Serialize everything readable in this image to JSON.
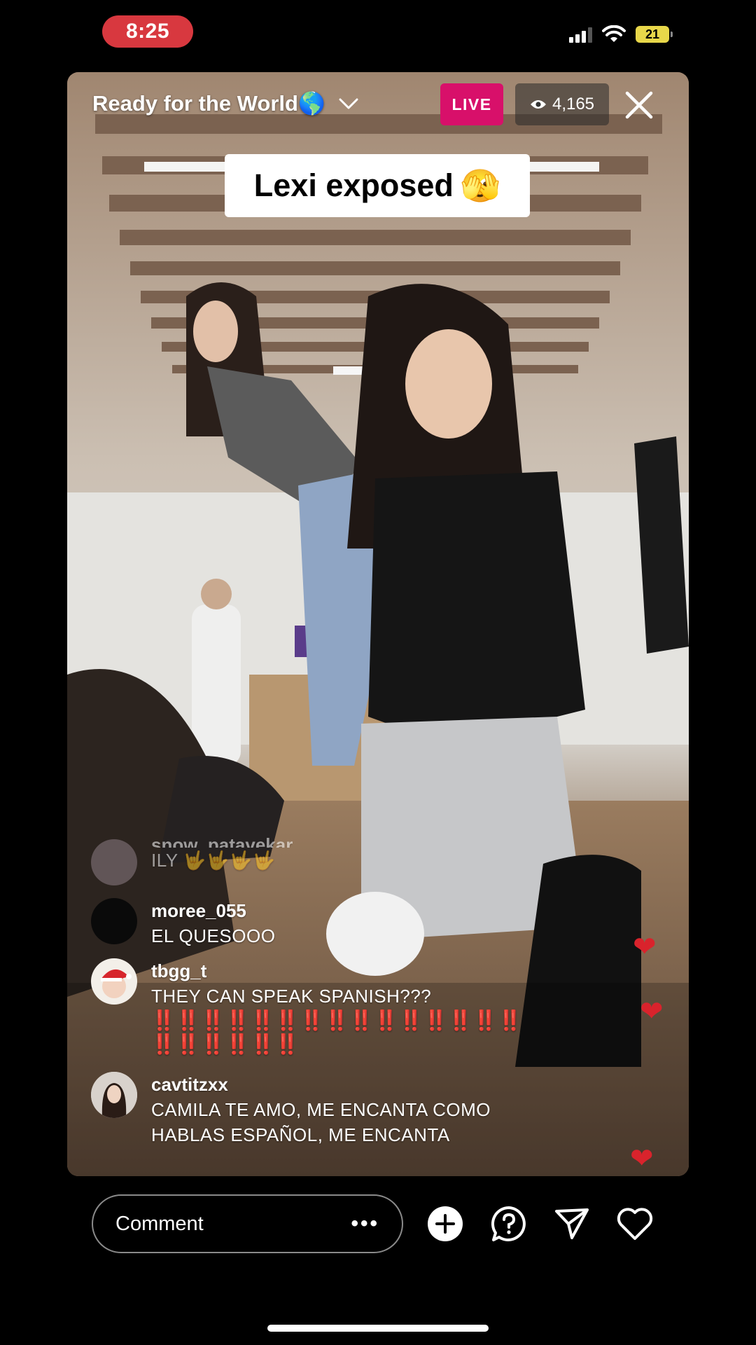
{
  "status_bar": {
    "time": "8:25",
    "battery": "21"
  },
  "stream": {
    "title": "Ready for the World🌎",
    "live_label": "LIVE",
    "viewer_count": "4,165",
    "caption": "Lexi exposed",
    "caption_emoji": "🫣"
  },
  "comments": [
    {
      "user": "snow_patavekar",
      "text": "ILY 🤟🤟🤟🤟"
    },
    {
      "user": "moree_055",
      "text": "EL QUESOOO"
    },
    {
      "user": "tbgg_t",
      "text": "THEY CAN SPEAK SPANISH???",
      "text2": "‼️‼️‼️‼️‼️‼️‼️‼️‼️‼️‼️‼️‼️‼️‼️",
      "text3": "‼️‼️‼️‼️‼️‼️"
    },
    {
      "user": "cavtitzxx",
      "text": "CAMILA TE AMO, ME ENCANTA COMO",
      "text2": "HABLAS ESPAÑOL, ME ENCANTA"
    }
  ],
  "bottom_bar": {
    "comment_placeholder": "Comment",
    "more": "•••"
  },
  "colors": {
    "live": "#d8106a",
    "time_pill": "#d8383f",
    "heart": "#d9232c",
    "battery": "#e8d74a"
  },
  "icons": [
    "wifi-icon",
    "signal-icon",
    "battery-icon",
    "chevron-down-icon",
    "eye-icon",
    "close-icon",
    "plus-circle-icon",
    "question-bubble-icon",
    "send-icon",
    "heart-icon"
  ]
}
